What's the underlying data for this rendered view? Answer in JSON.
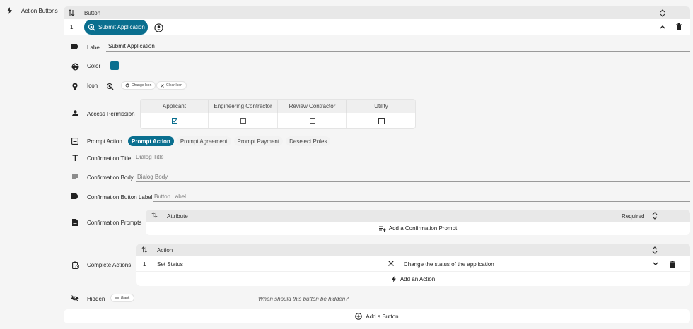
{
  "sidebar": {
    "label": "Action Buttons"
  },
  "buttons_table": {
    "header": "Button",
    "row": {
      "index": "1",
      "button_label": "Submit Application"
    }
  },
  "button_accent": "#0a6f8f",
  "form": {
    "label_field": {
      "label": "Label",
      "value": "Submit Application"
    },
    "color_field": {
      "label": "Color",
      "value": "#0a6f8f"
    },
    "icon_field": {
      "label": "Icon",
      "change_label": "Change Icon",
      "clear_label": "Clear Icon"
    },
    "access": {
      "label": "Access Permission",
      "roles": [
        {
          "name": "Applicant",
          "checked": true
        },
        {
          "name": "Engineering Contractor",
          "checked": false
        },
        {
          "name": "Review Contractor",
          "checked": false
        },
        {
          "name": "Utility",
          "checked": false
        }
      ]
    },
    "prompt_action": {
      "label": "Prompt Action",
      "options": [
        "Prompt Action",
        "Prompt Agreement",
        "Prompt Payment",
        "Deselect Poles"
      ],
      "selected": "Prompt Action"
    },
    "confirmation_title": {
      "label": "Confirmation Title",
      "placeholder": "Dialog Title"
    },
    "confirmation_body": {
      "label": "Confirmation Body",
      "placeholder": "Dialog Body"
    },
    "confirmation_button_label": {
      "label": "Confirmation Button Label",
      "placeholder": "Button Label"
    },
    "confirmation_prompts": {
      "label": "Confirmation Prompts",
      "col_attribute": "Attribute",
      "col_required": "Required",
      "add_label": "Add a Confirmation Prompt"
    },
    "complete_actions": {
      "label": "Complete Actions",
      "col_action": "Action",
      "rows": [
        {
          "index": "1",
          "action": "Set Status",
          "description": "Change the status of the application"
        }
      ],
      "add_label": "Add an Action"
    },
    "hidden": {
      "label": "Hidden",
      "chip_label": "Blank",
      "hint": "When should this button be hidden?"
    }
  },
  "footer": {
    "add_button_label": "Add a Button"
  }
}
